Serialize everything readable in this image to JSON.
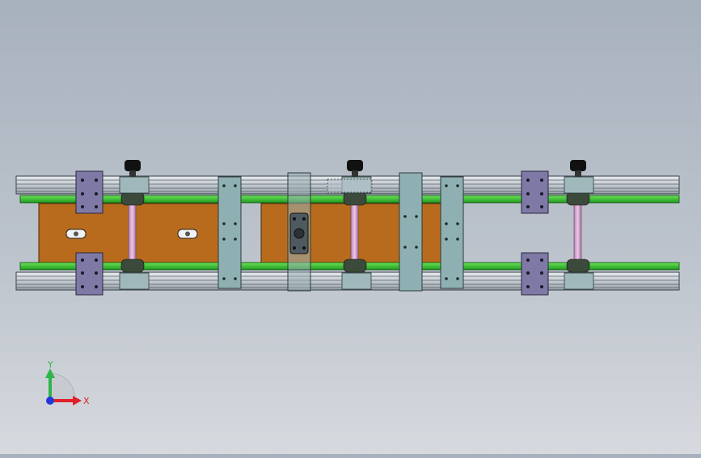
{
  "window": {
    "title": ""
  },
  "viewport": {
    "background": "#b4bcc6",
    "view": "Front"
  },
  "model": {
    "parts": [
      "aluminium-profile-rail",
      "green-conveyor-chain",
      "orange-carrier-plate",
      "purple-bearing-block",
      "teal-connecting-plate",
      "pink-drive-shaft",
      "black-knob"
    ],
    "colors": {
      "rail": "#c9d0d8",
      "chain": "#33c52a",
      "plate": "#b86b1c",
      "bearing_block": "#7f79a5",
      "connector": "#8fb0b2",
      "shaft": "#d7a7cf",
      "knob": "#111111"
    }
  },
  "triad": {
    "x_label": "X",
    "y_label": "Y",
    "x_color": "#e0202a",
    "y_color": "#2db54a",
    "z_color": "#2438d8"
  }
}
